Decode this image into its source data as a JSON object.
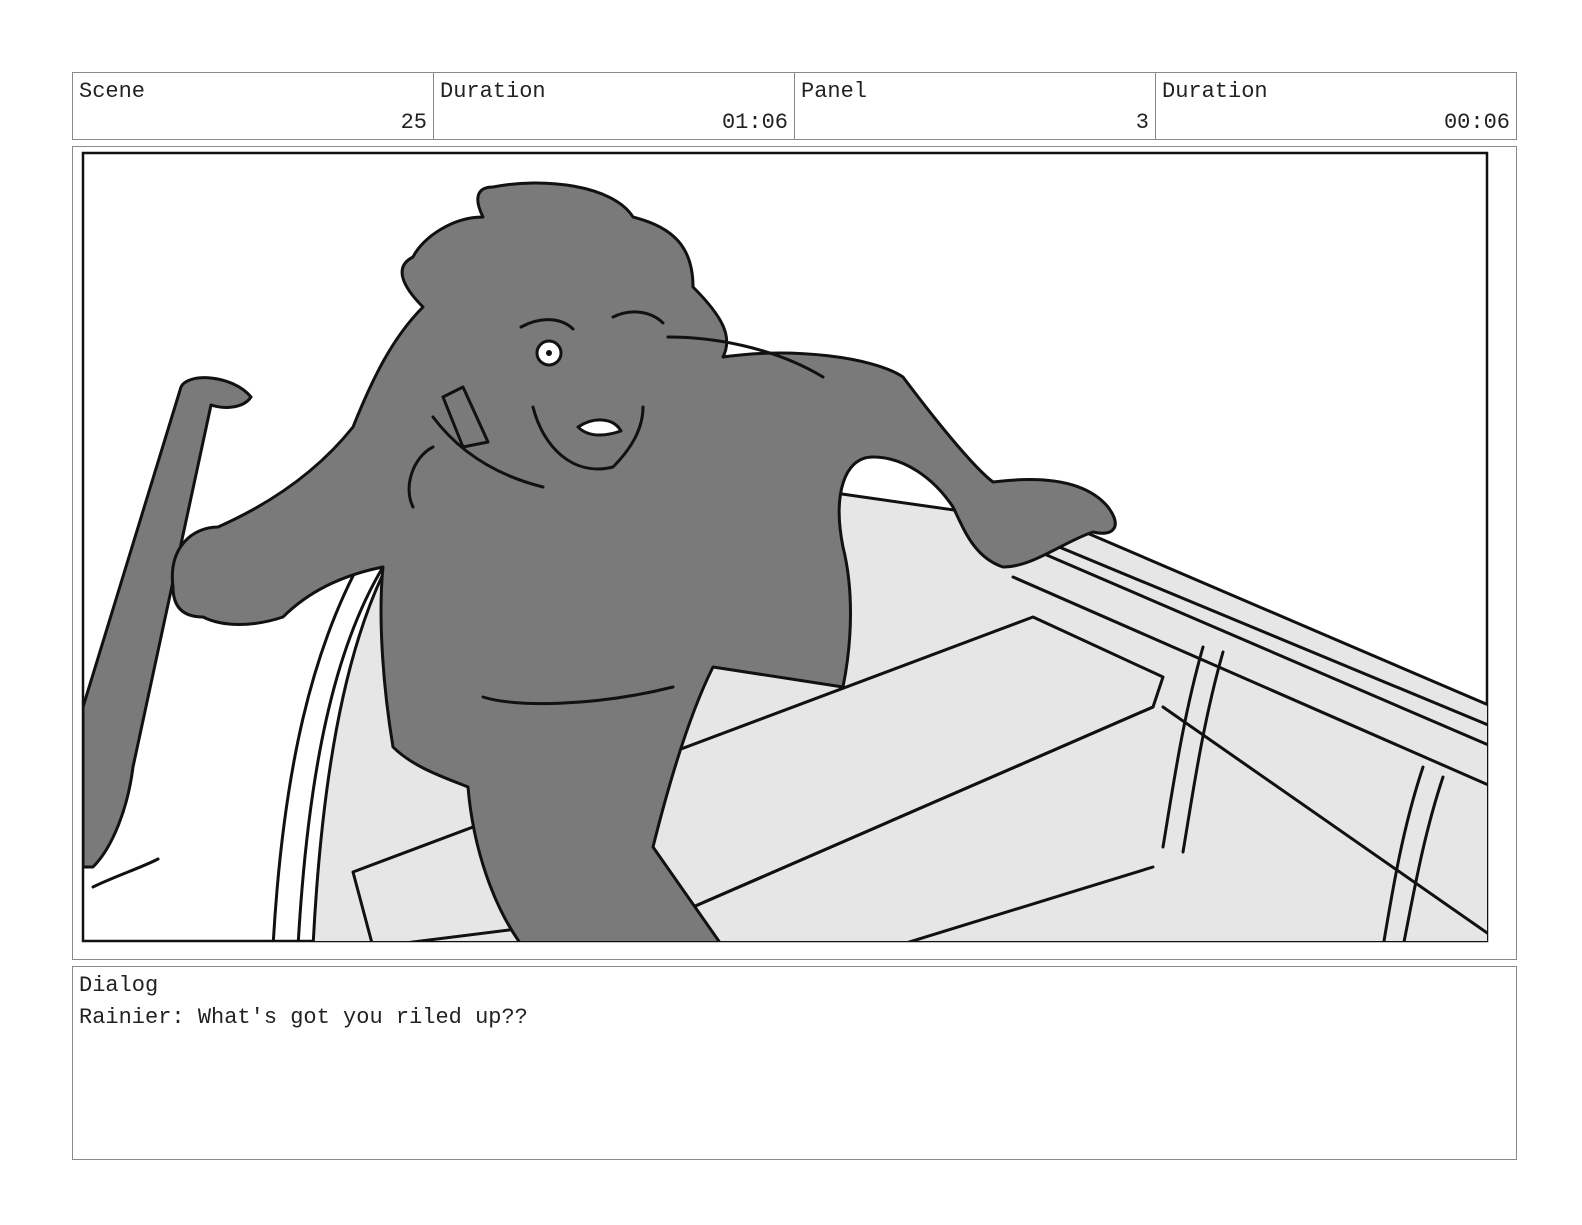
{
  "header": {
    "scene_label": "Scene",
    "scene_value": "25",
    "scene_duration_label": "Duration",
    "scene_duration_value": "01:06",
    "panel_label": "Panel",
    "panel_value": "3",
    "panel_duration_label": "Duration",
    "panel_duration_value": "00:06"
  },
  "panel": {
    "icon": "storyboard-sketch-bearded-man-rowing-boat"
  },
  "dialog": {
    "label": "Dialog",
    "text": "Rainier: What's got you riled up??"
  }
}
